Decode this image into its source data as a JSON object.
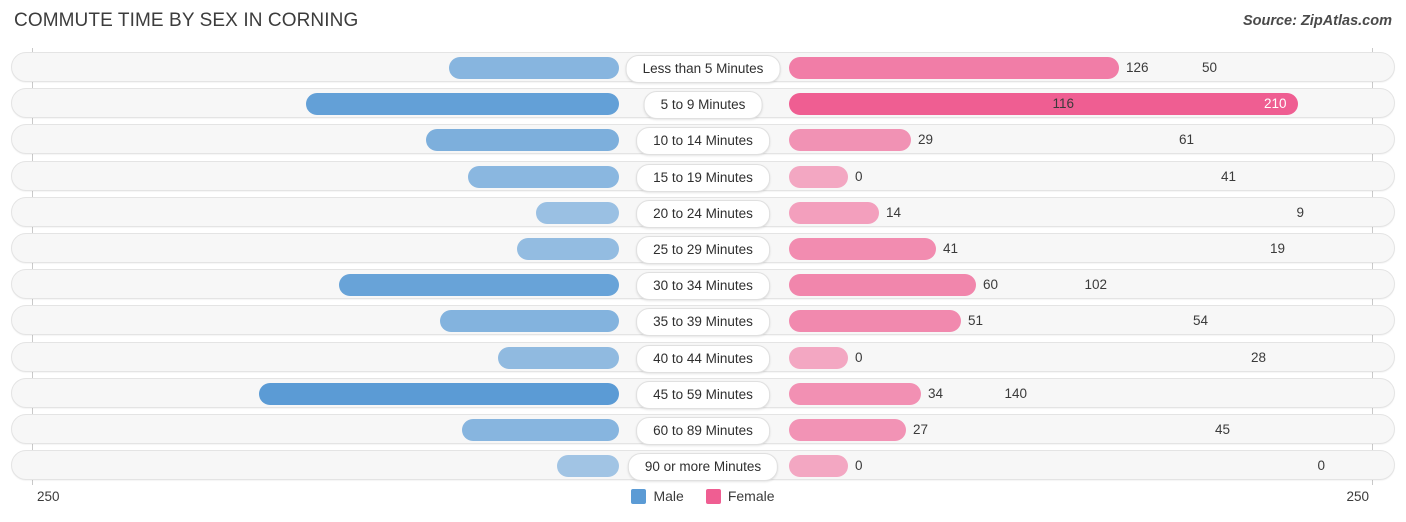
{
  "header": {
    "title": "COMMUTE TIME BY SEX IN CORNING",
    "source": "Source: ZipAtlas.com"
  },
  "axis": {
    "left_tick": "250",
    "right_tick": "250",
    "max": 250
  },
  "legend": [
    {
      "label": "Male",
      "color": "#5b9bd5"
    },
    {
      "label": "Female",
      "color": "#ef5e92"
    }
  ],
  "chart_data": {
    "type": "bar",
    "title": "COMMUTE TIME BY SEX IN CORNING",
    "subtitle": "Source: ZipAtlas.com",
    "orientation": "horizontal-diverging",
    "xlabel": "",
    "ylabel": "",
    "xlim": [
      -250,
      250
    ],
    "axis_tick_labels": [
      "250",
      "250"
    ],
    "grid": false,
    "legend_position": "bottom-center",
    "categories": [
      "Less than 5 Minutes",
      "5 to 9 Minutes",
      "10 to 14 Minutes",
      "15 to 19 Minutes",
      "20 to 24 Minutes",
      "25 to 29 Minutes",
      "30 to 34 Minutes",
      "35 to 39 Minutes",
      "40 to 44 Minutes",
      "45 to 59 Minutes",
      "60 to 89 Minutes",
      "90 or more Minutes"
    ],
    "series": [
      {
        "name": "Male",
        "color": "#5b9bd5",
        "side": "left",
        "values": [
          50,
          116,
          61,
          41,
          9,
          19,
          102,
          54,
          28,
          140,
          45,
          0
        ]
      },
      {
        "name": "Female",
        "color": "#ef5e92",
        "side": "right",
        "values": [
          126,
          210,
          29,
          0,
          14,
          41,
          60,
          51,
          0,
          34,
          27,
          0
        ]
      }
    ]
  },
  "rows": [
    {
      "category": "Less than 5 Minutes",
      "male": "50",
      "female": "126",
      "male_start": 448,
      "female_end": 1118,
      "female_inside": false,
      "male_alpha": 0.72,
      "female_alpha": 0.8
    },
    {
      "category": "5 to 9 Minutes",
      "male": "116",
      "female": "210",
      "male_start": 305,
      "female_end": 1297,
      "female_inside": true,
      "male_alpha": 0.95,
      "female_alpha": 1.0
    },
    {
      "category": "10 to 14 Minutes",
      "male": "61",
      "female": "29",
      "male_start": 425,
      "female_end": 910,
      "female_inside": false,
      "male_alpha": 0.78,
      "female_alpha": 0.66
    },
    {
      "category": "15 to 19 Minutes",
      "male": "41",
      "female": "0",
      "male_start": 467,
      "female_end": 847,
      "female_inside": false,
      "male_alpha": 0.7,
      "female_alpha": 0.52
    },
    {
      "category": "20 to 24 Minutes",
      "male": "9",
      "female": "14",
      "male_start": 535,
      "female_end": 878,
      "female_inside": false,
      "male_alpha": 0.6,
      "female_alpha": 0.58
    },
    {
      "category": "25 to 29 Minutes",
      "male": "19",
      "female": "41",
      "male_start": 516,
      "female_end": 935,
      "female_inside": false,
      "male_alpha": 0.64,
      "female_alpha": 0.7
    },
    {
      "category": "30 to 34 Minutes",
      "male": "102",
      "female": "60",
      "male_start": 338,
      "female_end": 975,
      "female_inside": false,
      "male_alpha": 0.92,
      "female_alpha": 0.74
    },
    {
      "category": "35 to 39 Minutes",
      "male": "54",
      "female": "51",
      "male_start": 439,
      "female_end": 960,
      "female_inside": false,
      "male_alpha": 0.74,
      "female_alpha": 0.72
    },
    {
      "category": "40 to 44 Minutes",
      "male": "28",
      "female": "0",
      "male_start": 497,
      "female_end": 847,
      "female_inside": false,
      "male_alpha": 0.66,
      "female_alpha": 0.52
    },
    {
      "category": "45 to 59 Minutes",
      "male": "140",
      "female": "34",
      "male_start": 258,
      "female_end": 920,
      "female_inside": false,
      "male_alpha": 1.0,
      "female_alpha": 0.68
    },
    {
      "category": "60 to 89 Minutes",
      "male": "45",
      "female": "27",
      "male_start": 461,
      "female_end": 905,
      "female_inside": false,
      "male_alpha": 0.72,
      "female_alpha": 0.65
    },
    {
      "category": "90 or more Minutes",
      "male": "0",
      "female": "0",
      "male_start": 556,
      "female_end": 847,
      "female_inside": false,
      "male_alpha": 0.55,
      "female_alpha": 0.52
    }
  ]
}
